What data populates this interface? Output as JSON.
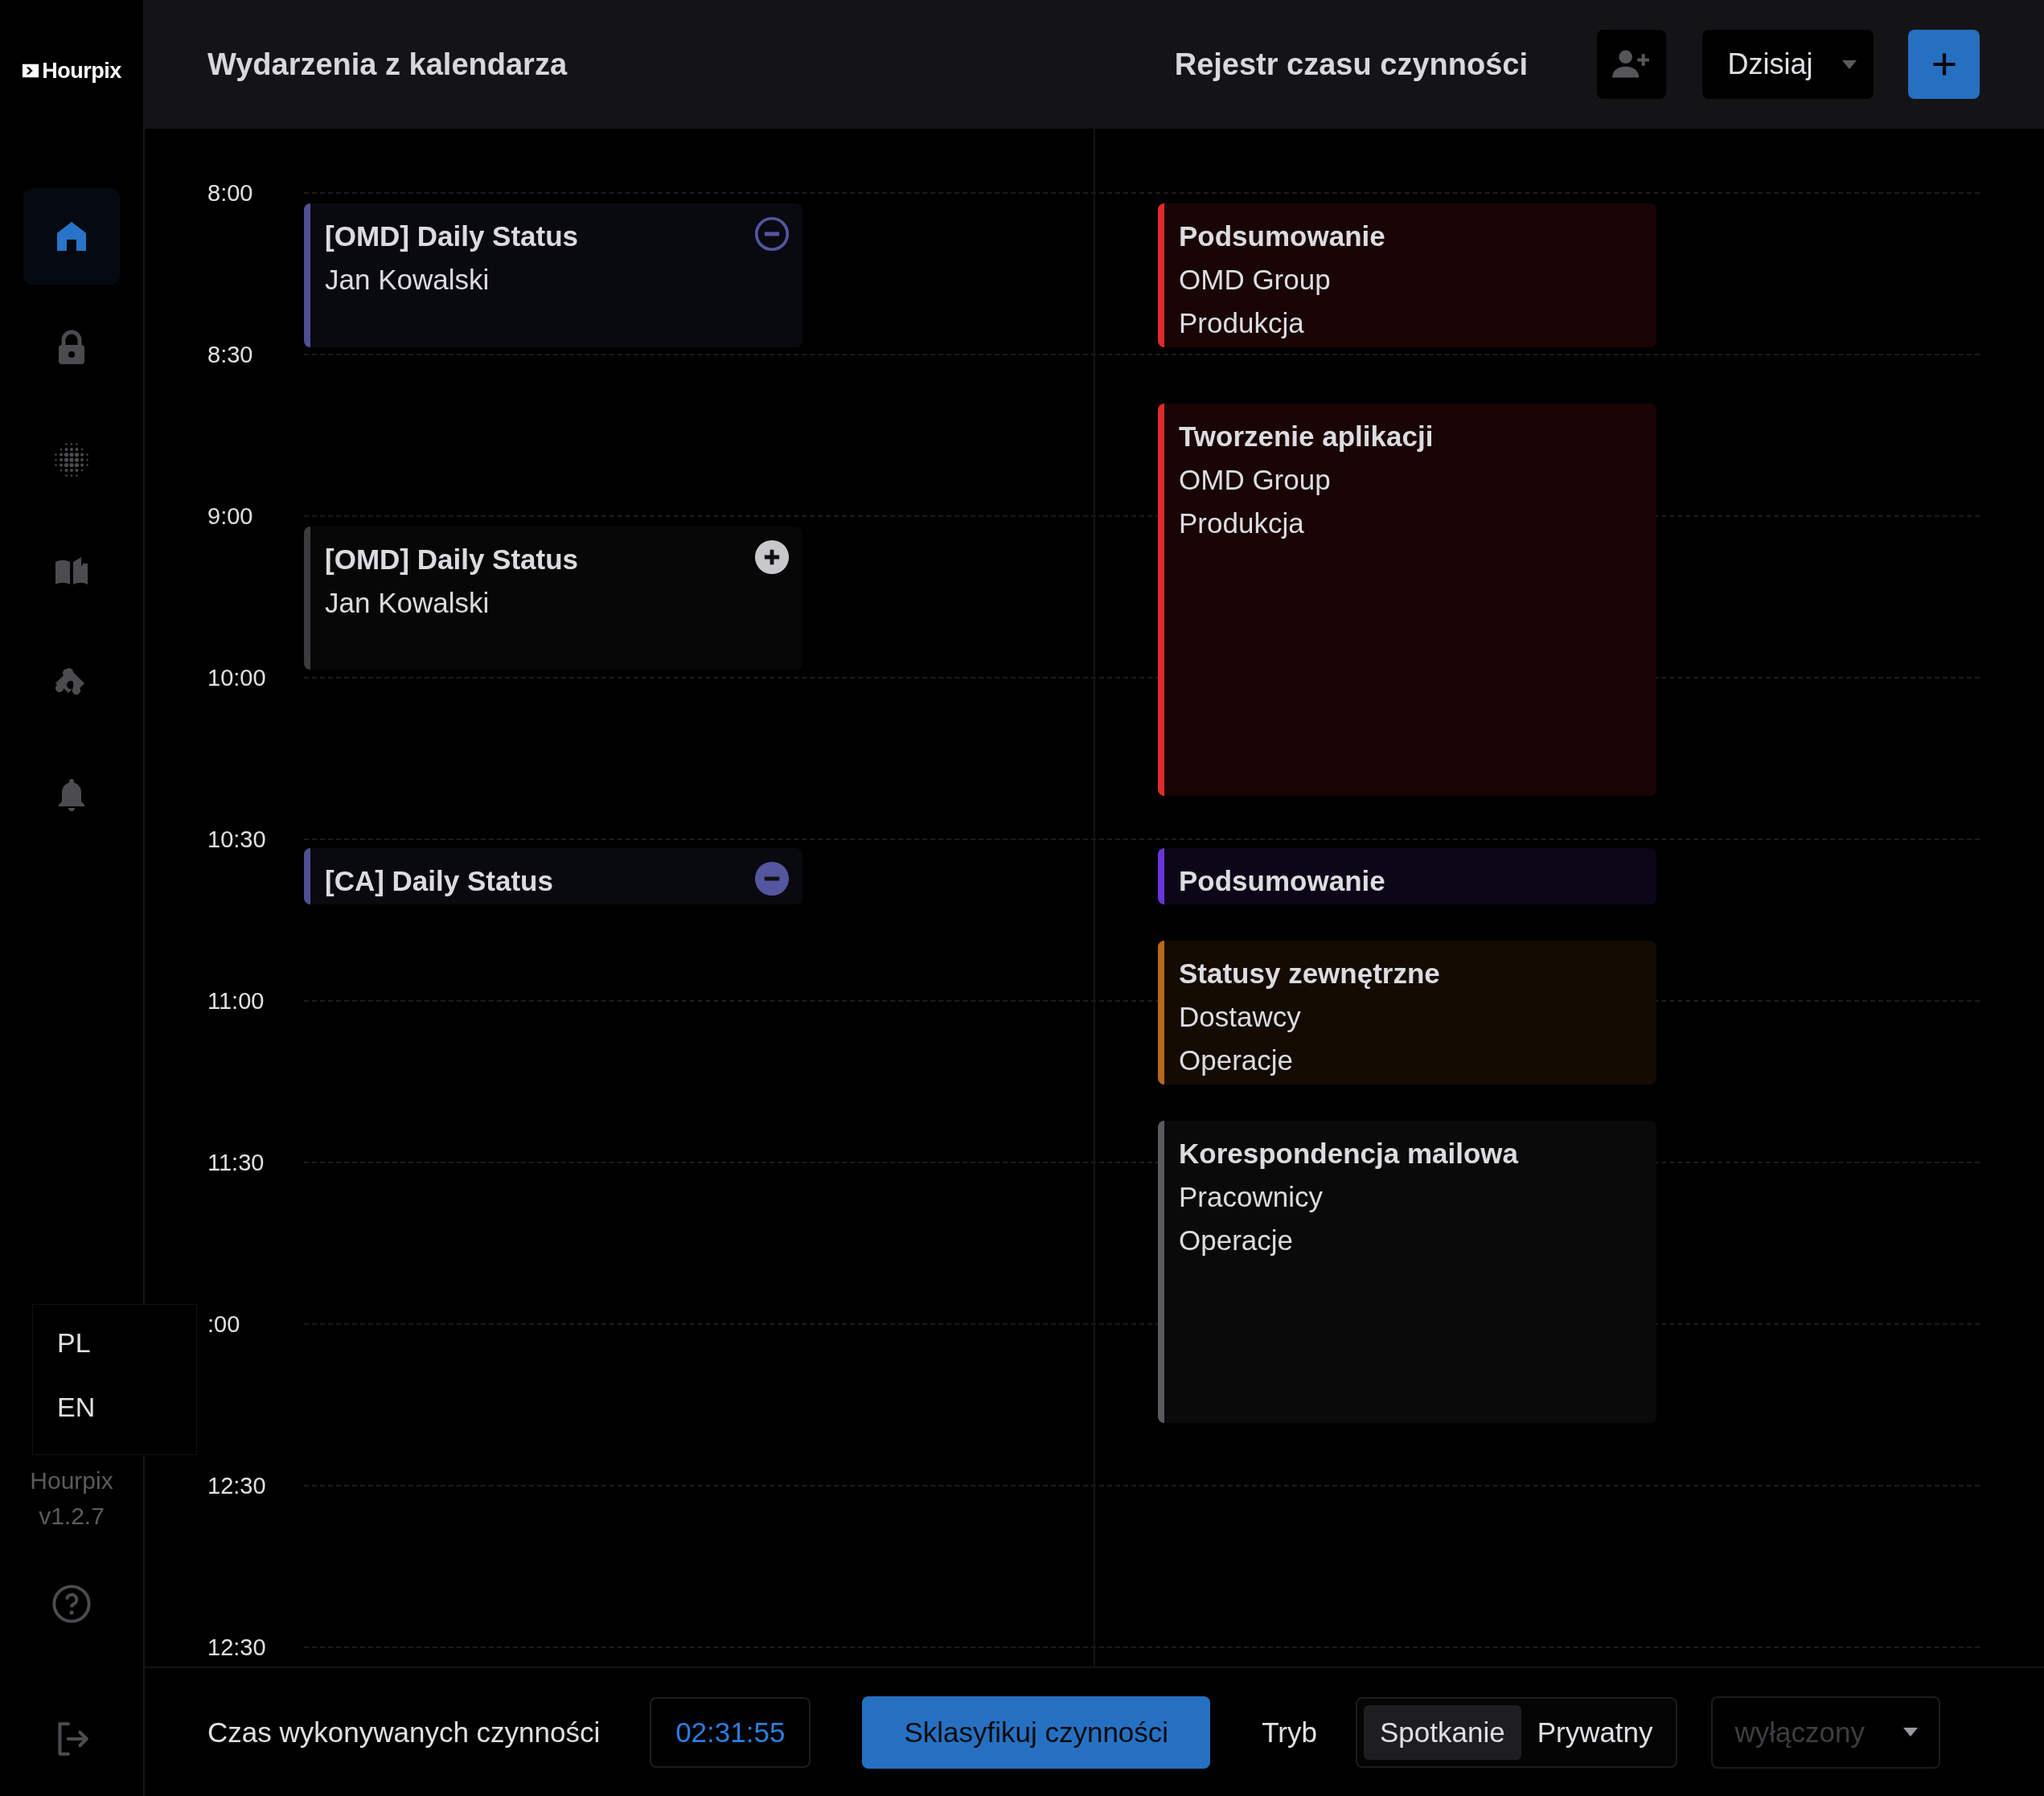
{
  "sidebar": {
    "logo": "Hourpix",
    "items": [
      {
        "selected": true
      },
      {
        "selected": false
      },
      {
        "selected": false
      },
      {
        "selected": false
      },
      {
        "selected": false
      },
      {
        "selected": false
      }
    ],
    "language_menu": {
      "options": [
        "PL",
        "EN"
      ]
    },
    "app_name": "Hourpix",
    "version": "v1.2.7"
  },
  "header": {
    "title": "Wydarzenia z kalendarza",
    "log_title": "Rejestr czasu czynności",
    "period": "Dzisiaj"
  },
  "timeline": {
    "times": [
      "8:00",
      "8:30",
      "9:00",
      "10:00",
      "10:30",
      "11:00",
      "11:30",
      ":00",
      "12:30",
      "12:30"
    ],
    "calendar_events": [
      {
        "title": "[OMD] Daily Status",
        "subtitle": "Jan Kowalski",
        "color": "#4f4f95",
        "included": true,
        "icon_filled": false
      },
      {
        "title": "[OMD] Daily Status",
        "subtitle": "Jan Kowalski",
        "color": "#3c3c3e",
        "included": false,
        "icon_filled": true
      },
      {
        "title": "[CA] Daily Status",
        "color": "#4f4f95",
        "included": true,
        "icon_filled": true
      }
    ],
    "activity_entries": [
      {
        "title": "Podsumowanie",
        "client": "OMD Group",
        "category": "Produkcja",
        "color": "#e02b2b"
      },
      {
        "title": "Tworzenie aplikacji",
        "client": "OMD Group",
        "category": "Produkcja",
        "color": "#e02b2b"
      },
      {
        "title": "Podsumowanie",
        "color": "#6a35d8"
      },
      {
        "title": "Statusy zewnętrzne",
        "client": "Dostawcy",
        "category": "Operacje",
        "color": "#b8681c"
      },
      {
        "title": "Korespondencja mailowa",
        "client": "Pracownicy",
        "category": "Operacje",
        "color": "#5a5a5e"
      }
    ]
  },
  "footer": {
    "label": "Czas wykonywanych czynności",
    "timer": "02:31:55",
    "classify_button": "Sklasyfikuj czynności",
    "mode_label": "Tryb",
    "mode_options": [
      {
        "label": "Spotkanie",
        "selected": true
      },
      {
        "label": "Prywatny",
        "selected": false
      }
    ],
    "status": {
      "value": "wyłączony",
      "disabled": true
    }
  }
}
